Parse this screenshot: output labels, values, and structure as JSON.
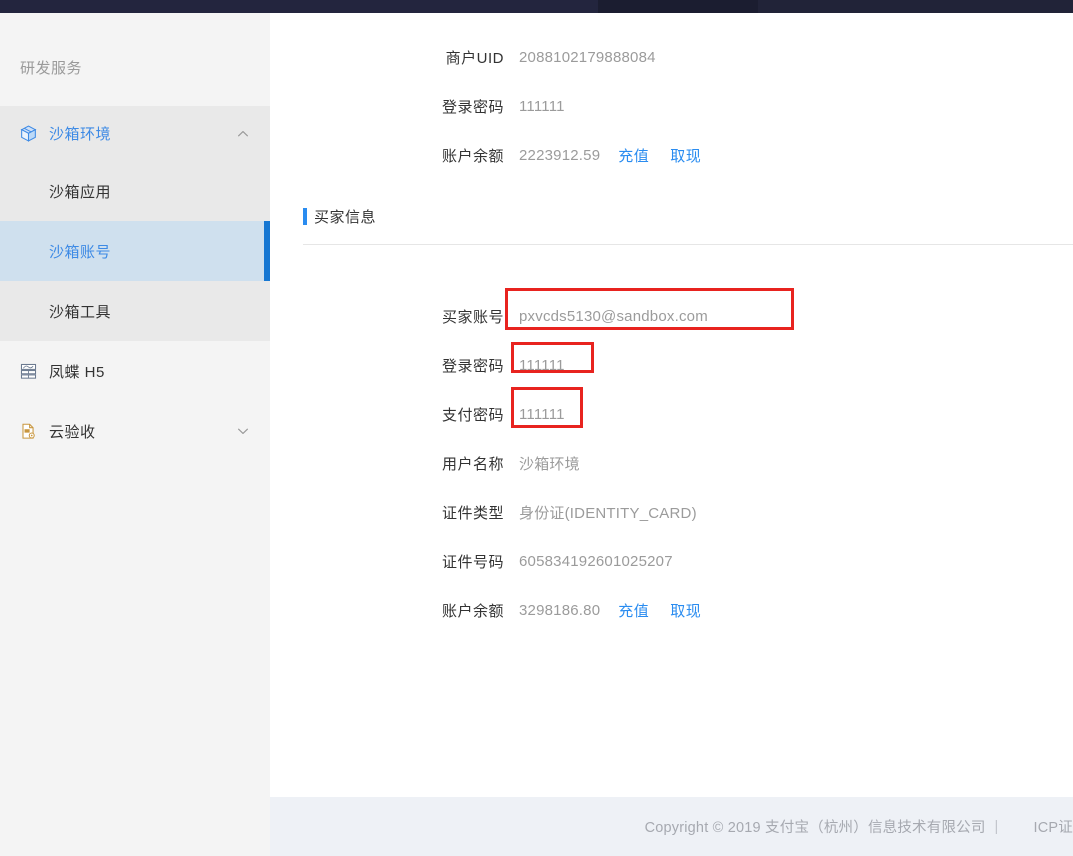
{
  "topbar": {
    "segments": [
      "",
      "",
      ""
    ]
  },
  "sidebar": {
    "title": "研发服务",
    "groups": [
      {
        "label": "沙箱环境",
        "icon": "cube-icon",
        "expanded": true,
        "chevron": "chevron-up-icon",
        "children": [
          {
            "label": "沙箱应用",
            "selected": false
          },
          {
            "label": "沙箱账号",
            "selected": true
          },
          {
            "label": "沙箱工具",
            "selected": false
          }
        ]
      }
    ],
    "standalone": [
      {
        "label": "凤蝶 H5",
        "icon": "layers-icon",
        "chevron": null
      },
      {
        "label": "云验收",
        "icon": "document-gear-icon",
        "chevron": "chevron-down-icon"
      }
    ]
  },
  "merchant": {
    "rows": [
      {
        "label": "商户UID",
        "value": "2088102179888084",
        "actions": []
      },
      {
        "label": "登录密码",
        "value": "111111",
        "actions": []
      },
      {
        "label": "账户余额",
        "value": "2223912.59",
        "actions": [
          "充值",
          "取现"
        ]
      }
    ]
  },
  "buyer_section": {
    "title": "买家信息",
    "rows": [
      {
        "label": "买家账号",
        "value": "pxvcds5130@sandbox.com",
        "actions": [],
        "highlight": "account"
      },
      {
        "label": "登录密码",
        "value": "111111",
        "actions": [],
        "highlight": "login"
      },
      {
        "label": "支付密码",
        "value": "111111",
        "actions": [],
        "highlight": "pay"
      },
      {
        "label": "用户名称",
        "value": "沙箱环境",
        "actions": [],
        "highlight": null
      },
      {
        "label": "证件类型",
        "value": "身份证(IDENTITY_CARD)",
        "actions": [],
        "highlight": null
      },
      {
        "label": "证件号码",
        "value": "605834192601025207",
        "actions": [],
        "highlight": null
      },
      {
        "label": "账户余额",
        "value": "3298186.80",
        "actions": [
          "充值",
          "取现"
        ],
        "highlight": null
      }
    ]
  },
  "footer": {
    "copyright": "Copyright © 2019 支付宝（杭州）信息技术有限公司",
    "separator": "|",
    "icp": "ICP证"
  },
  "colors": {
    "accent_blue": "#2a8cf0",
    "link_blue": "#2a8cf0",
    "highlight_red": "#e8231f",
    "topbar_dark": "#20223a",
    "sidebar_bg": "#f4f4f4",
    "sidebar_group_bg": "#e9e9e9",
    "sidebar_selected_bg": "#cfe0ee",
    "sidebar_selected_bar": "#1677d2",
    "footer_bg": "#eef1f6",
    "label_text": "#333333",
    "value_text": "#9b9b9b"
  }
}
